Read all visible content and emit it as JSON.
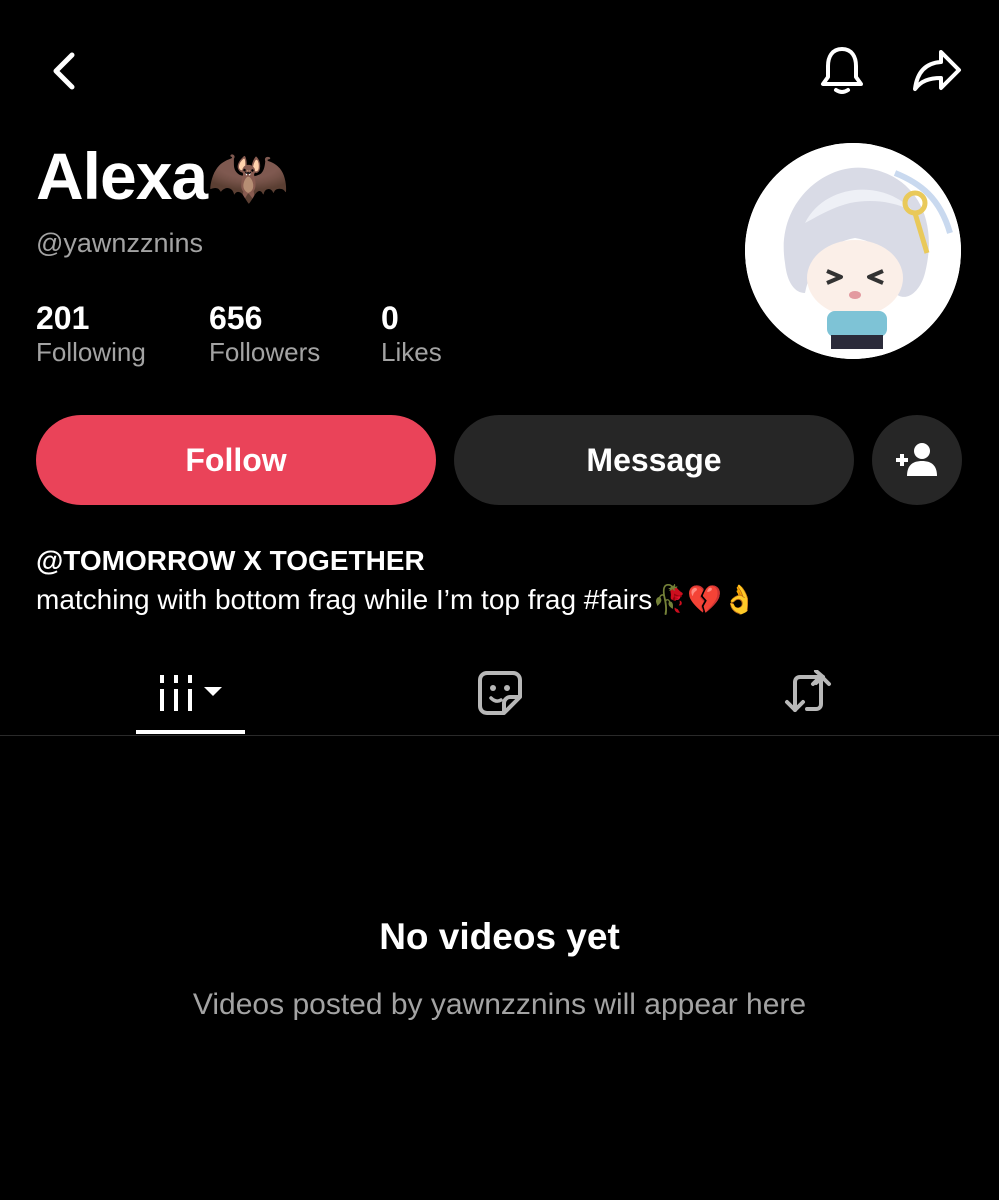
{
  "profile": {
    "display_name": "Alexa🦇",
    "username": "@yawnzznins",
    "stats": [
      {
        "value": "201",
        "label": "Following"
      },
      {
        "value": "656",
        "label": "Followers"
      },
      {
        "value": "0",
        "label": "Likes"
      }
    ],
    "bio": {
      "line1": "@TOMORROW X TOGETHER",
      "line2": "matching with bottom frag while I’m top frag #fairs🥀💔👌"
    }
  },
  "actions": {
    "follow_label": "Follow",
    "message_label": "Message"
  },
  "topbar": {
    "icons": [
      "back-icon",
      "bell-icon",
      "share-icon"
    ]
  },
  "tabs": {
    "items": [
      "videos-grid-icon",
      "liked-sticker-icon",
      "reposts-icon"
    ],
    "active": 0
  },
  "empty_state": {
    "title": "No videos yet",
    "subtitle": "Videos posted by yawnzznins will appear here"
  },
  "colors": {
    "background": "#000000",
    "follow_button": "#ea4359",
    "secondary_button": "#262626",
    "muted_text": "#a3a3a3"
  }
}
